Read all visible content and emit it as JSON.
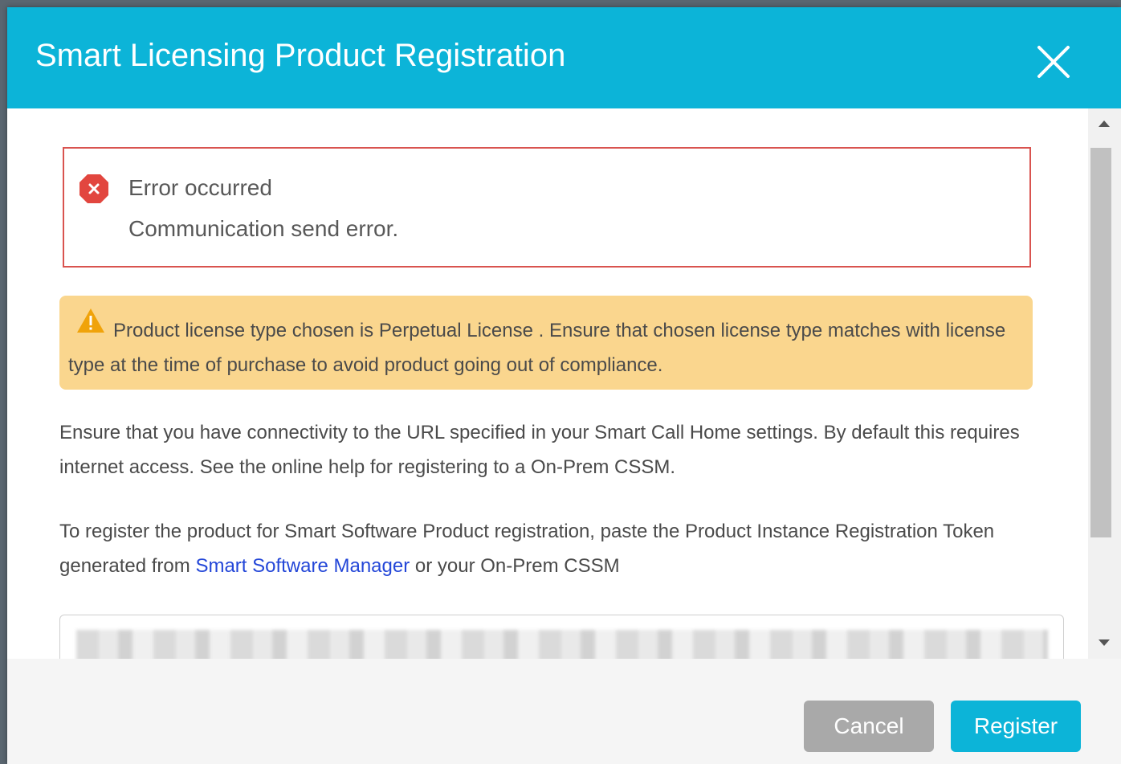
{
  "dialog": {
    "title": "Smart Licensing Product Registration",
    "close_icon": "close-icon"
  },
  "error": {
    "icon": "error-x-icon",
    "title": "Error occurred",
    "message": "Communication send error."
  },
  "warning": {
    "icon": "warning-triangle-icon",
    "text": "Product license type chosen is Perpetual License . Ensure that chosen license type matches with license type at the time of purchase to avoid product going out of compliance."
  },
  "info": {
    "paragraph1": "Ensure that you have connectivity to the URL specified in your Smart Call Home settings. By default this requires internet access. See the online help for registering to a On-Prem CSSM.",
    "paragraph2_before": "To register the product for Smart Software Product registration, paste the Product Instance Registration Token generated from ",
    "paragraph2_link": "Smart Software Manager",
    "paragraph2_after": " or your On-Prem CSSM"
  },
  "footer": {
    "cancel_label": "Cancel",
    "register_label": "Register"
  },
  "colors": {
    "header": "#0cb4d8",
    "error_border": "#d9534f",
    "error_icon": "#e2463f",
    "warning_bg": "#fad68e",
    "warning_icon": "#f0a30a",
    "link": "#2447d8",
    "cancel": "#a9a9a9",
    "register": "#0cb4d8"
  }
}
